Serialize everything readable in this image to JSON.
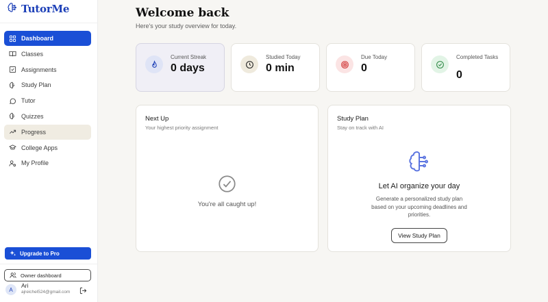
{
  "brand": {
    "name": "TutorMe"
  },
  "nav": [
    {
      "label": "Dashboard"
    },
    {
      "label": "Classes"
    },
    {
      "label": "Assignments"
    },
    {
      "label": "Study Plan"
    },
    {
      "label": "Tutor"
    },
    {
      "label": "Quizzes"
    },
    {
      "label": "Progress"
    },
    {
      "label": "College Apps"
    },
    {
      "label": "My Profile"
    }
  ],
  "upgrade": {
    "label": "Upgrade to Pro"
  },
  "owner": {
    "label": "Owner dashboard"
  },
  "user": {
    "initial": "A",
    "name": "Ari",
    "email": "ajreichel524@gmail.com"
  },
  "header": {
    "title": "Welcome back",
    "subtitle": "Here's your study overview for today."
  },
  "stats": [
    {
      "label": "Current Streak",
      "value": "0 days",
      "icon": "flame-icon"
    },
    {
      "label": "Studied Today",
      "value": "0 min",
      "icon": "clock-icon"
    },
    {
      "label": "Due Today",
      "value": "0",
      "icon": "target-icon"
    },
    {
      "label": "Completed Tasks",
      "value": "0",
      "icon": "check-circle-icon"
    }
  ],
  "next_up": {
    "title": "Next Up",
    "subtitle": "Your highest priority assignment",
    "empty": "You're all caught up!"
  },
  "study_plan": {
    "title": "Study Plan",
    "subtitle": "Stay on track with AI",
    "heading": "Let AI organize your day",
    "description": "Generate a personalized study plan based on your upcoming deadlines and priorities.",
    "button": "View Study Plan"
  },
  "colors": {
    "accent": "#1a4fd6",
    "brand": "#1c3fb7",
    "streak": "#dfe4f6",
    "clock": "#efeadd",
    "due": "#fbe4e4",
    "done": "#e2f4e6"
  }
}
